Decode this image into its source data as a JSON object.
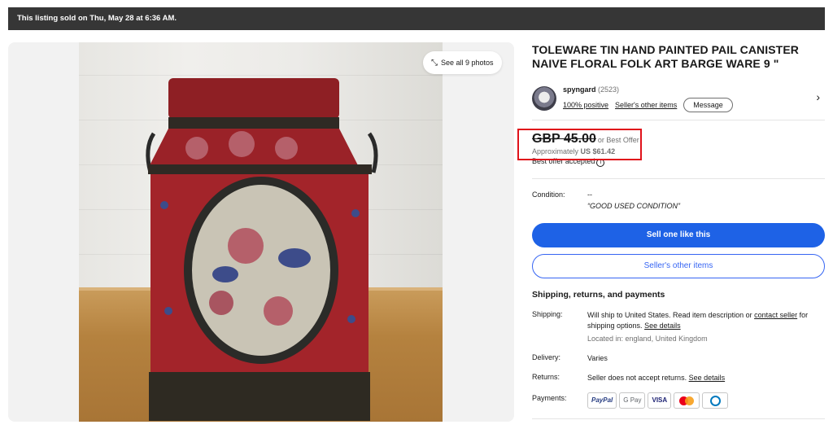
{
  "banner": {
    "text": "This listing sold on Thu, May 28 at 6:36 AM."
  },
  "gallery": {
    "see_all_label": "See all 9 photos",
    "expand_icon": "expand-icon"
  },
  "item": {
    "title": "TOLEWARE TIN HAND PAINTED PAIL CANISTER NAIVE FLORAL FOLK ART BARGE WARE 9 \""
  },
  "seller": {
    "name": "spyngard",
    "score": "(2523)",
    "positive": "100% positive",
    "other_items": "Seller's other items",
    "message_label": "Message"
  },
  "price": {
    "amount": "GBP 45.00",
    "offer": "or Best Offer",
    "approx_prefix": "Approximately",
    "approx_value": "US $61.42",
    "accepted": "Best offer accepted"
  },
  "condition": {
    "label": "Condition:",
    "value": "--",
    "detail": "“GOOD USED CONDITION”"
  },
  "actions": {
    "sell_label": "Sell one like this",
    "other_items_label": "Seller's other items"
  },
  "shipping": {
    "heading": "Shipping, returns, and payments",
    "shipping_label": "Shipping:",
    "shipping_text_1": "Will ship to United States. Read item description or",
    "contact_link": "contact seller",
    "shipping_text_2": "for shipping options.",
    "see_details": "See details",
    "location": "Located in: england, United Kingdom",
    "delivery_label": "Delivery:",
    "delivery_value": "Varies",
    "returns_label": "Returns:",
    "returns_value": "Seller does not accept returns.",
    "returns_link": "See details",
    "payments_label": "Payments:",
    "payment_methods": [
      "PayPal",
      "G Pay",
      "VISA"
    ]
  },
  "colors": {
    "primary": "#1e62e6",
    "highlight": "#e0121a",
    "banner": "#363636"
  }
}
